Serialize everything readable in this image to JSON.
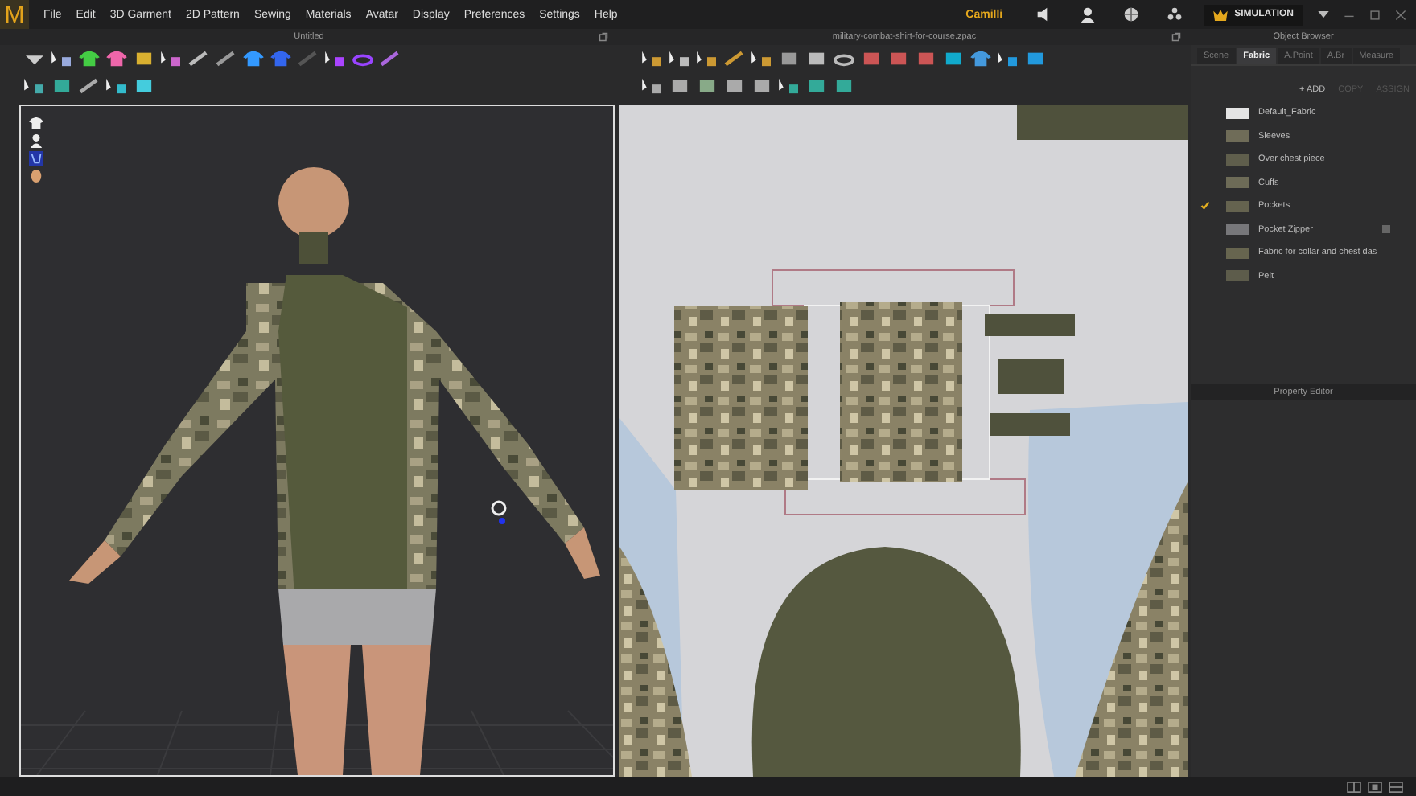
{
  "logo": "M",
  "menu": [
    "File",
    "Edit",
    "3D Garment",
    "2D Pattern",
    "Sewing",
    "Materials",
    "Avatar",
    "Display",
    "Preferences",
    "Settings",
    "Help"
  ],
  "user_name": "Camilli",
  "mode_button": "SIMULATION",
  "viewport_3d": {
    "title": "Untitled"
  },
  "viewport_2d": {
    "title": "military-combat-shirt-for-course.zpac"
  },
  "object_browser": {
    "title": "Object Browser",
    "tabs": [
      {
        "label": "Scene",
        "selected": false
      },
      {
        "label": "Fabric",
        "selected": true
      },
      {
        "label": "A.Point",
        "selected": false
      },
      {
        "label": "A.Br",
        "selected": false
      },
      {
        "label": "Measure",
        "selected": false
      }
    ],
    "actions": [
      {
        "label": "+ ADD",
        "disabled": false
      },
      {
        "label": "COPY",
        "disabled": true
      },
      {
        "label": "ASSIGN",
        "disabled": true
      }
    ],
    "fabrics": [
      {
        "name": "Default_Fabric",
        "color": "#e4e4e4",
        "checked": false,
        "has_trim": false
      },
      {
        "name": "Sleeves",
        "color": "#6f6c58",
        "checked": false,
        "has_trim": false
      },
      {
        "name": "Over chest piece",
        "color": "#5f5e4c",
        "checked": false,
        "has_trim": false
      },
      {
        "name": "Cuffs",
        "color": "#6d6b57",
        "checked": false,
        "has_trim": false
      },
      {
        "name": "Pockets",
        "color": "#65634f",
        "checked": true,
        "has_trim": false
      },
      {
        "name": "Pocket Zipper",
        "color": "#77777a",
        "checked": false,
        "has_trim": true
      },
      {
        "name": "Fabric for collar and chest das",
        "color": "#67654f",
        "checked": false,
        "has_trim": false
      },
      {
        "name": "Pelt",
        "color": "#5d5c4b",
        "checked": false,
        "has_trim": false
      }
    ]
  },
  "property_editor": {
    "title": "Property Editor"
  }
}
